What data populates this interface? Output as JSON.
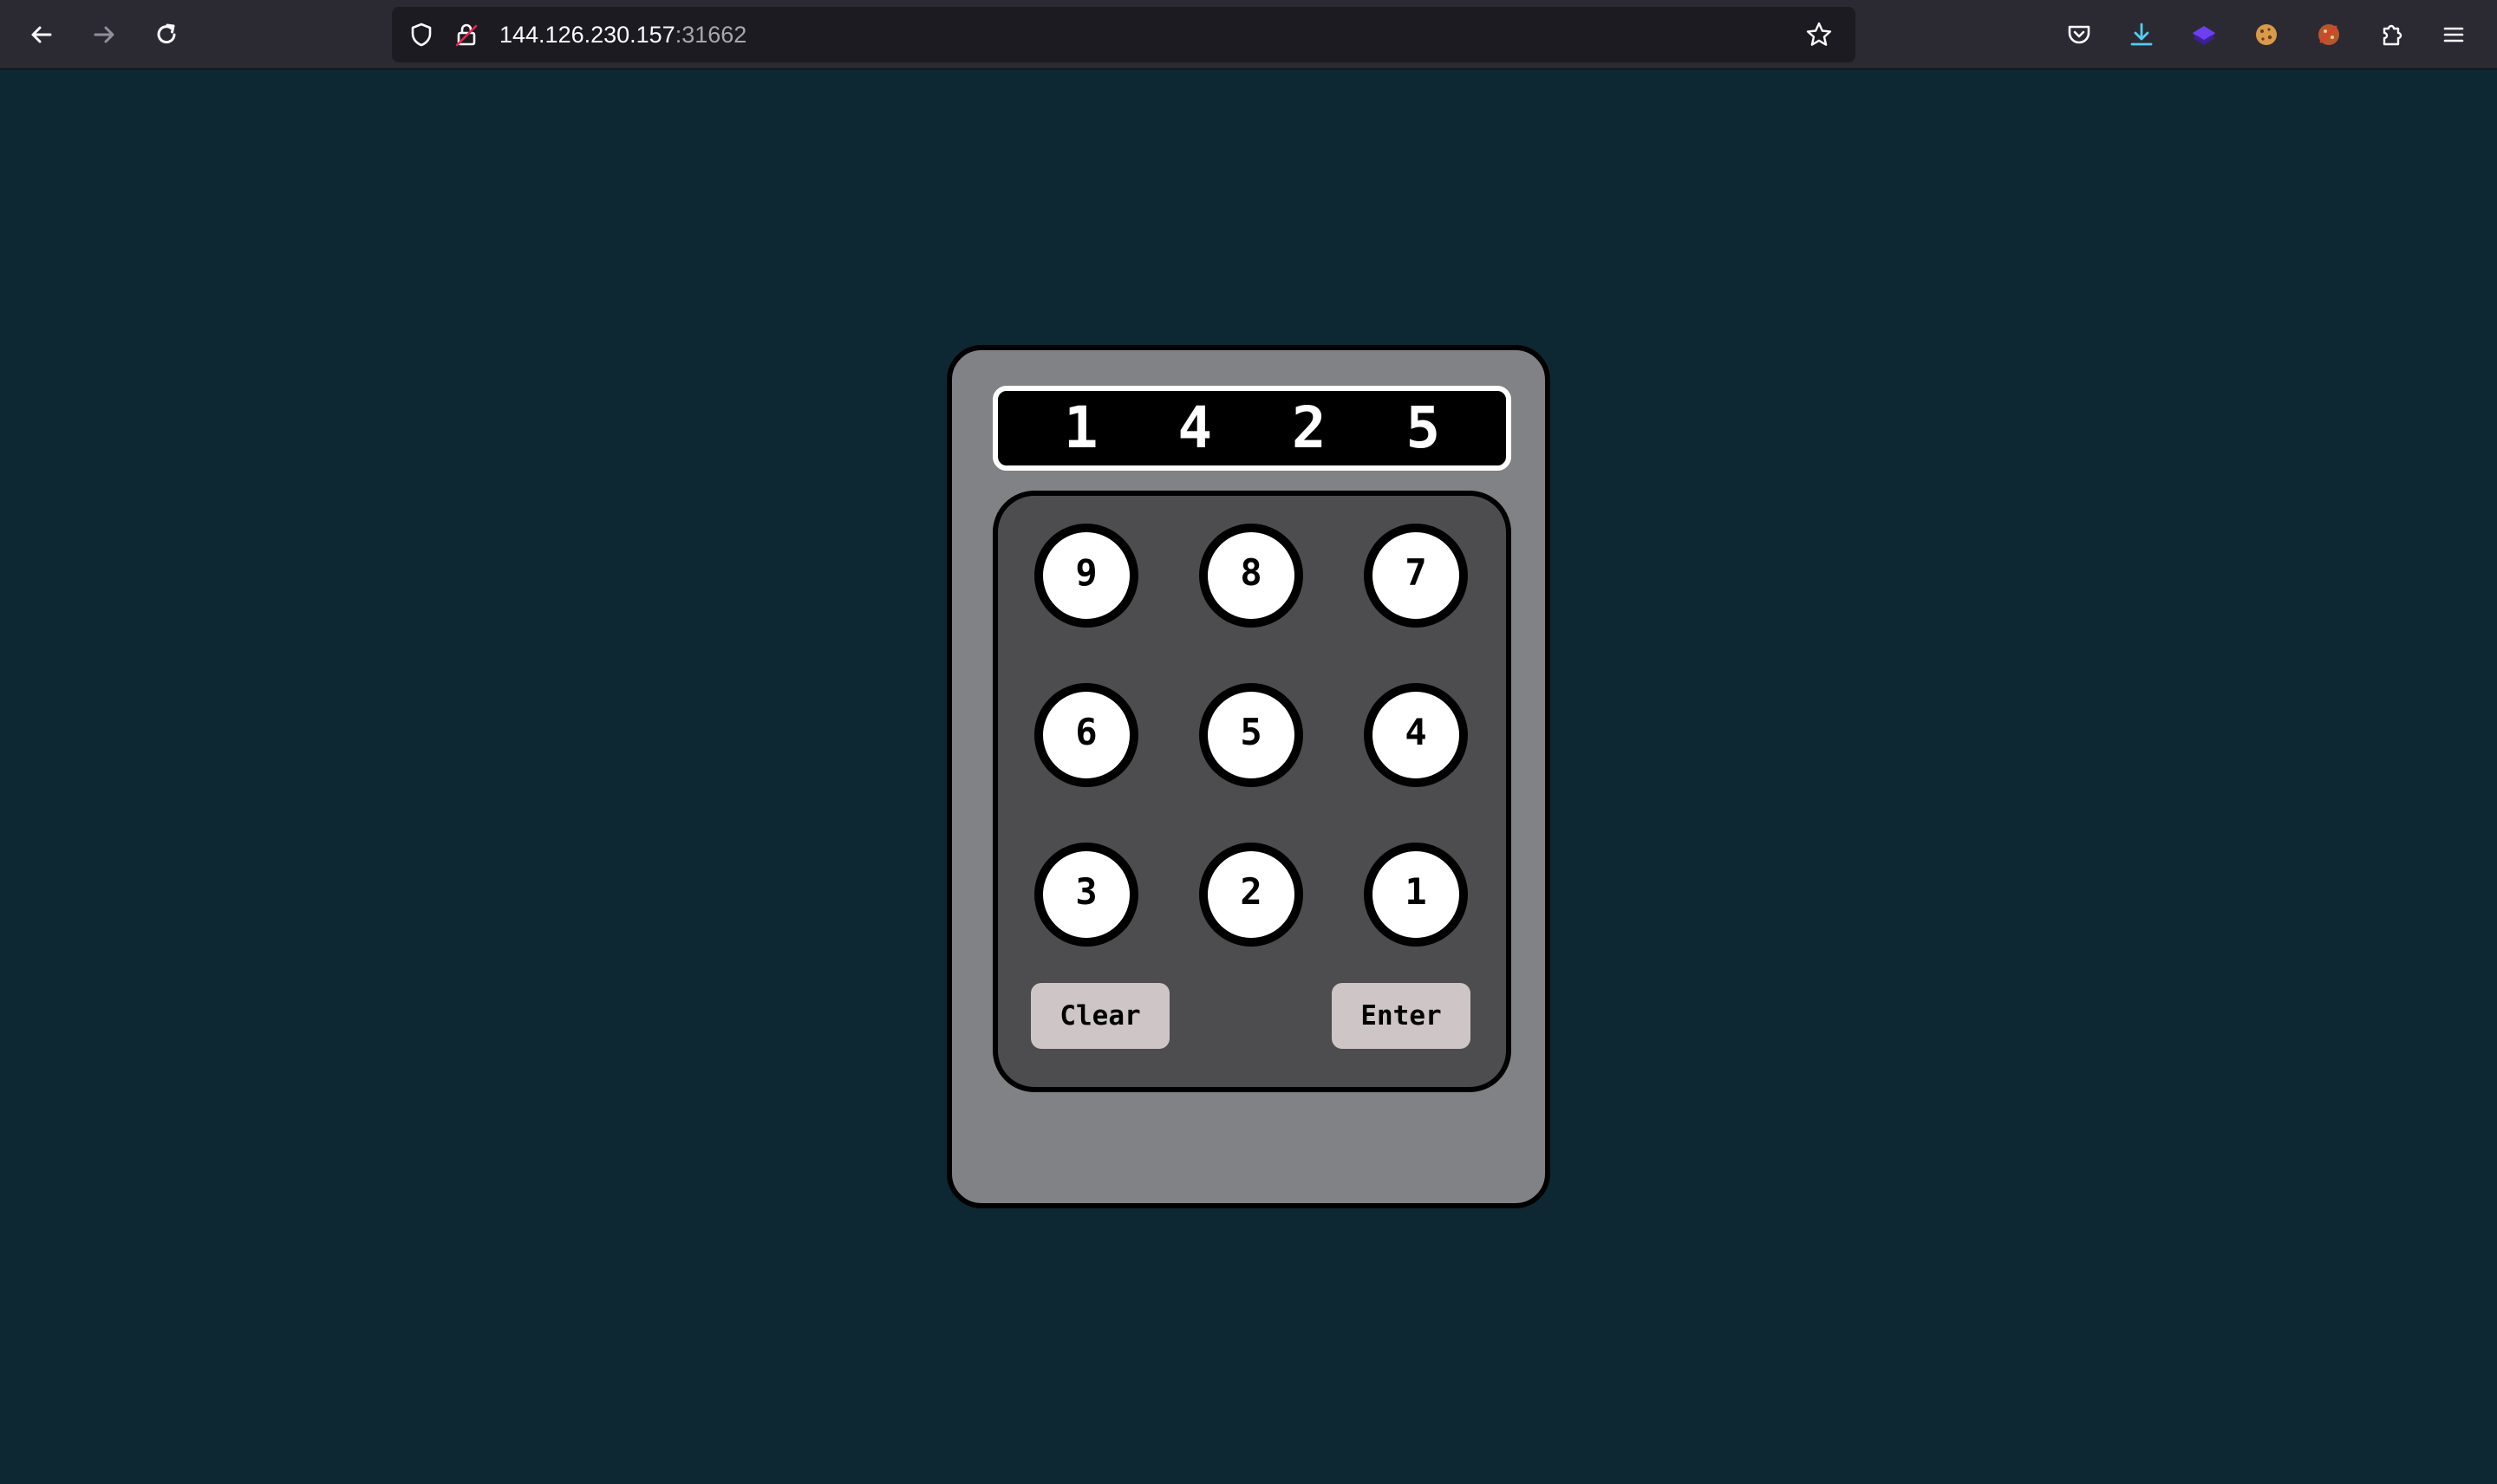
{
  "browser": {
    "url_host": "144.126.230.157",
    "url_port": ":31662",
    "icons": {
      "back": "arrow-left-icon",
      "forward": "arrow-right-icon",
      "reload": "reload-icon",
      "tracking": "shield-icon",
      "insecure": "lock-insecure-icon",
      "bookmark": "star-icon",
      "pocket": "pocket-icon",
      "downloads": "download-icon",
      "extension1": "layers-extension-icon",
      "extension2": "cookie-extension-icon",
      "extension3": "cookie-editor-extension-icon",
      "extensions": "puzzle-icon",
      "menu": "hamburger-menu-icon"
    }
  },
  "keypad": {
    "display": "1 4 2 5",
    "keys": [
      "9",
      "8",
      "7",
      "6",
      "5",
      "4",
      "3",
      "2",
      "1"
    ],
    "clear_label": "Clear",
    "enter_label": "Enter"
  },
  "colors": {
    "page_background": "#0e2833",
    "device_body": "#808285",
    "pad_background": "#4d4d50",
    "action_button": "#cdc5c6"
  }
}
